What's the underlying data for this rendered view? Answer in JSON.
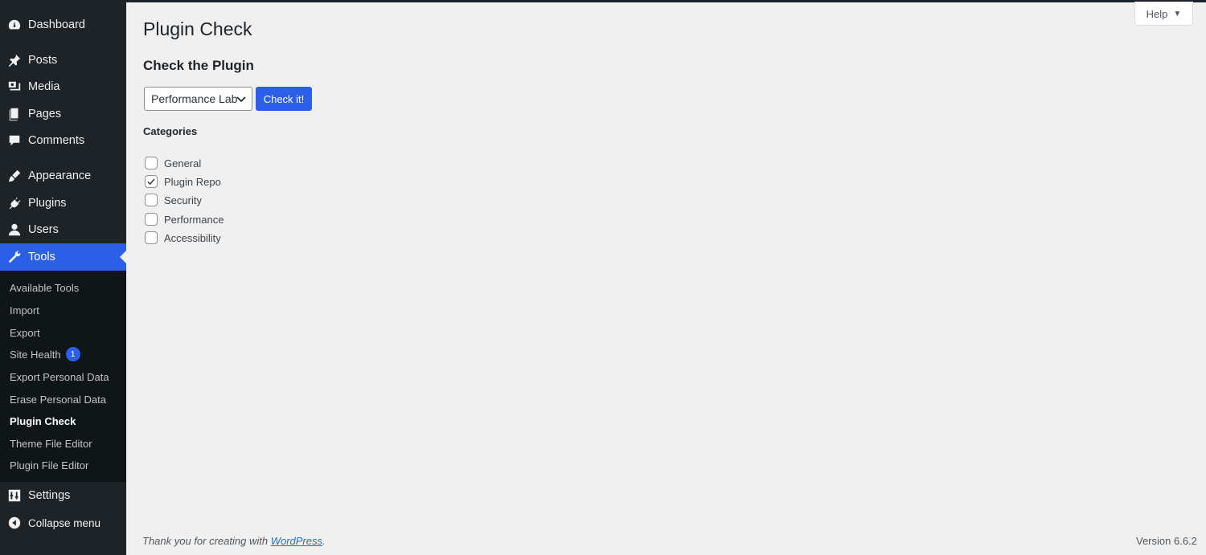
{
  "sidebar": {
    "items": [
      {
        "label": "Dashboard",
        "icon": "dashboard-icon"
      },
      {
        "label": "Posts",
        "icon": "pin-icon"
      },
      {
        "label": "Media",
        "icon": "media-icon"
      },
      {
        "label": "Pages",
        "icon": "pages-icon"
      },
      {
        "label": "Comments",
        "icon": "comments-icon"
      },
      {
        "label": "Appearance",
        "icon": "brush-icon"
      },
      {
        "label": "Plugins",
        "icon": "plugins-icon"
      },
      {
        "label": "Users",
        "icon": "users-icon"
      },
      {
        "label": "Tools",
        "icon": "wrench-icon",
        "active": true
      }
    ],
    "submenu": [
      {
        "label": "Available Tools"
      },
      {
        "label": "Import"
      },
      {
        "label": "Export"
      },
      {
        "label": "Site Health",
        "badge": "1"
      },
      {
        "label": "Export Personal Data"
      },
      {
        "label": "Erase Personal Data"
      },
      {
        "label": "Plugin Check",
        "current": true
      },
      {
        "label": "Theme File Editor"
      },
      {
        "label": "Plugin File Editor"
      }
    ],
    "settings": {
      "label": "Settings",
      "icon": "settings-icon"
    },
    "collapse": {
      "label": "Collapse menu",
      "icon": "collapse-icon"
    }
  },
  "header": {
    "help_label": "Help",
    "title": "Plugin Check"
  },
  "main": {
    "section_title": "Check the Plugin",
    "plugin_select": {
      "selected": "Performance Lab"
    },
    "check_button": "Check it!",
    "categories_heading": "Categories",
    "categories": [
      {
        "label": "General",
        "checked": false
      },
      {
        "label": "Plugin Repo",
        "checked": true
      },
      {
        "label": "Security",
        "checked": false
      },
      {
        "label": "Performance",
        "checked": false
      },
      {
        "label": "Accessibility",
        "checked": false
      }
    ]
  },
  "footer": {
    "thanks_prefix": "Thank you for creating with ",
    "thanks_link": "WordPress",
    "thanks_suffix": ".",
    "version": "Version 6.6.2"
  },
  "colors": {
    "sidebar_bg": "#1d2327",
    "submenu_bg": "#101517",
    "accent": "#2c5fe8",
    "page_bg": "#f0f0f1"
  }
}
